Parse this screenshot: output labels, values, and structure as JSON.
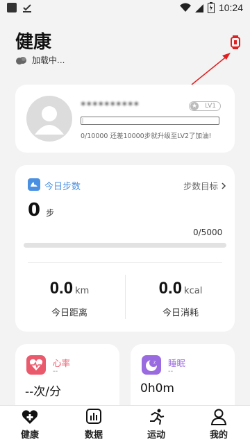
{
  "status_bar": {
    "time": "10:24"
  },
  "header": {
    "title": "健康",
    "sync_status": "加载中..."
  },
  "profile": {
    "username": "**********",
    "level_badge": "LV1",
    "progress_text": "0/10000 还差10000步就升级至LV2了加油!"
  },
  "steps": {
    "label": "今日步数",
    "goal_link": "步数目标",
    "count": "0",
    "unit": "步",
    "ratio": "0/5000",
    "progress": 0
  },
  "metrics": {
    "distance": {
      "value": "0.0",
      "unit": "km",
      "label": "今日距离"
    },
    "calories": {
      "value": "0.0",
      "unit": "kcal",
      "label": "今日消耗"
    }
  },
  "heart_rate": {
    "title": "心率",
    "sub": "--",
    "value": "--次/分",
    "color": "#ea5a6d"
  },
  "sleep": {
    "title": "睡眠",
    "sub": "--",
    "value": "0h0m",
    "color": "#9a6be0"
  },
  "nav": {
    "items": [
      {
        "label": "健康",
        "icon": "heart-plus-icon"
      },
      {
        "label": "数据",
        "icon": "bar-chart-icon"
      },
      {
        "label": "运动",
        "icon": "running-icon"
      },
      {
        "label": "我的",
        "icon": "person-icon"
      }
    ]
  },
  "colors": {
    "accent_blue": "#4a90e2",
    "annotation_red": "#e02020"
  }
}
